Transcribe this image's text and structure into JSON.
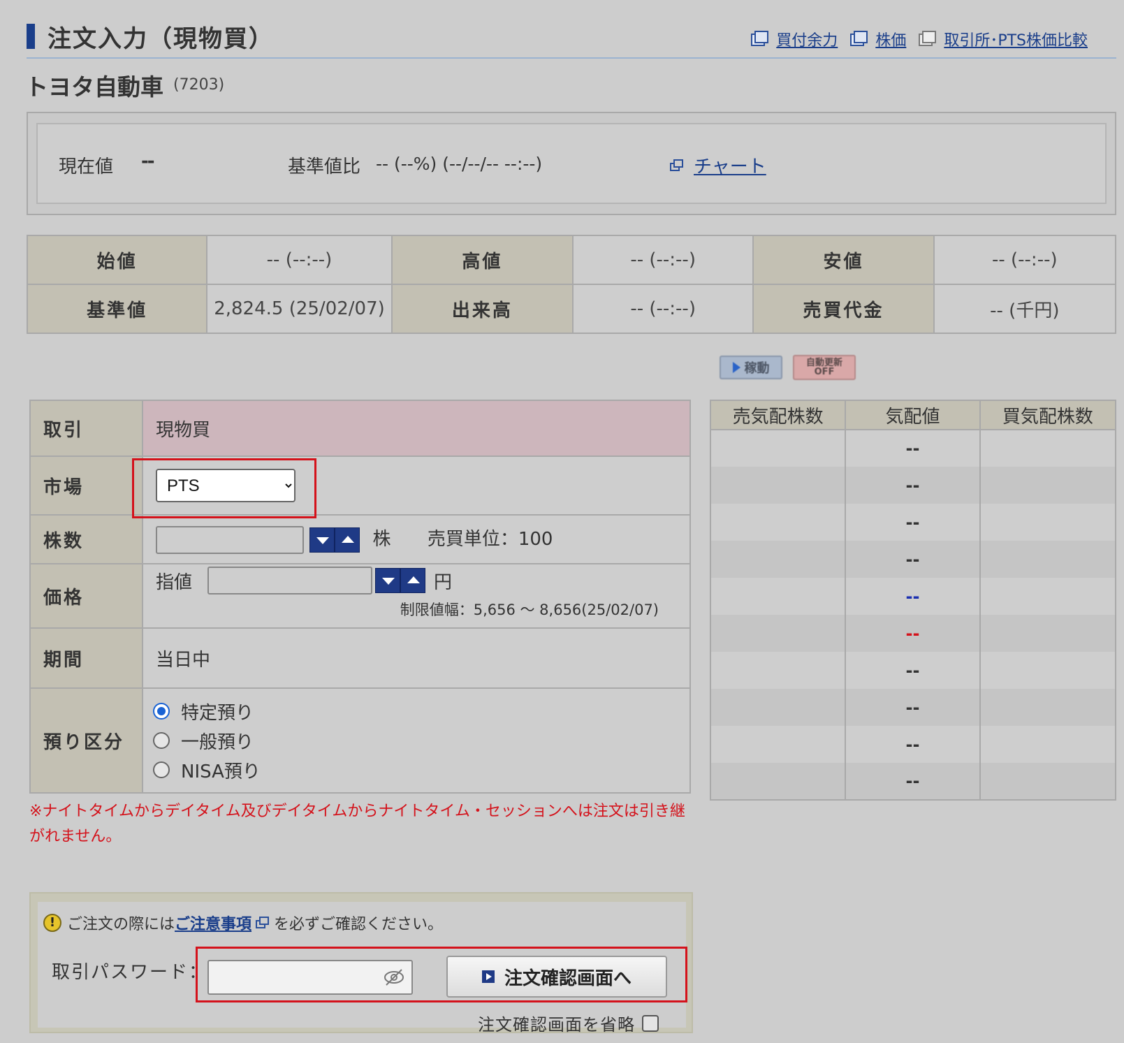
{
  "header": {
    "title": "注文入力（現物買）",
    "links": [
      "買付余力",
      "株価",
      "取引所･PTS株価比較"
    ]
  },
  "stock": {
    "name": "トヨタ自動車",
    "code": "(7203)"
  },
  "price_box": {
    "current_label": "現在値",
    "current_value": "--",
    "diff_label": "基準値比",
    "diff_value": "-- (--%) (--/--/-- --:--)",
    "chart_link": "チャート"
  },
  "quote": {
    "open_label": "始値",
    "open_value": "-- (--:--)",
    "high_label": "高値",
    "high_value": "-- (--:--)",
    "low_label": "安値",
    "low_value": "-- (--:--)",
    "base_label": "基準値",
    "base_value": "2,824.5 (25/02/07)",
    "volume_label": "出来高",
    "volume_value": "-- (--:--)",
    "turnover_label": "売買代金",
    "turnover_value": "-- (千円)"
  },
  "refresh": {
    "run_label": "稼動",
    "auto_label_1": "自動更新",
    "auto_label_2": "OFF"
  },
  "form": {
    "trade_label": "取引",
    "trade_value": "現物買",
    "market_label": "市場",
    "market_selected": "PTS",
    "qty_label": "株数",
    "qty_unit": "株",
    "lot_label": "売買単位：100",
    "price_label": "価格",
    "price_type": "指値",
    "price_unit": "円",
    "limit_range": "制限値幅：5,656 ～ 8,656(25/02/07)",
    "period_label": "期間",
    "period_value": "当日中",
    "deposit_label": "預り区分",
    "deposit_options": [
      "特定預り",
      "一般預り",
      "NISA預り"
    ]
  },
  "note": "※ナイトタイムからデイタイム及びデイタイムからナイトタイム・セッションへは注文は引き継がれません。",
  "board": {
    "headers": [
      "売気配株数",
      "気配値",
      "買気配株数"
    ],
    "prices": [
      "--",
      "--",
      "--",
      "--",
      "--",
      "--",
      "--",
      "--",
      "--",
      "--"
    ],
    "colors": {
      "ask_marker": "#1a2fb0",
      "bid_marker": "#d4121b"
    }
  },
  "confirm_panel": {
    "warn_prefix": "ご注文の際には",
    "warn_link": "ご注意事項",
    "warn_suffix": "を必ずご確認ください。",
    "pw_label": "取引パスワード：",
    "confirm_button": "注文確認画面へ",
    "skip_label": "注文確認画面を省略"
  }
}
